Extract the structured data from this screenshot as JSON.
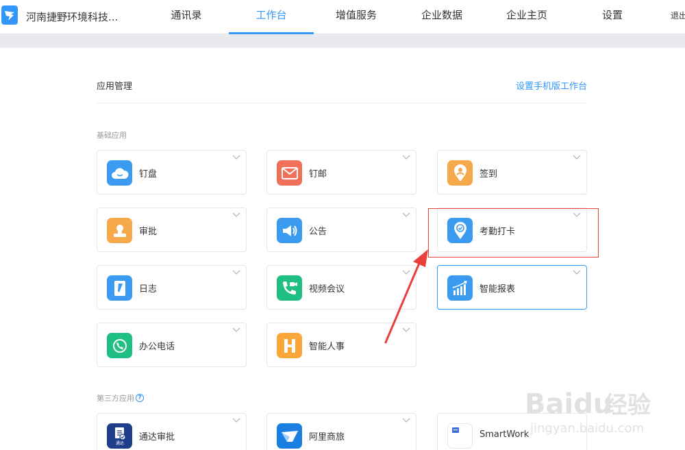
{
  "header": {
    "company": "河南捷野环境科技...",
    "tabs": [
      {
        "label": "通讯录"
      },
      {
        "label": "工作台"
      },
      {
        "label": "增值服务"
      },
      {
        "label": "企业数据"
      },
      {
        "label": "企业主页"
      },
      {
        "label": "设置"
      }
    ],
    "active_tab": "工作台",
    "logout": "退出"
  },
  "main": {
    "title": "应用管理",
    "mobile_link": "设置手机版工作台",
    "basic_label": "基础应用",
    "basic_apps": [
      {
        "name": "钉盘",
        "icon": "cloud-icon",
        "color": "#3a9bf0"
      },
      {
        "name": "钉邮",
        "icon": "mail-icon",
        "color": "#f0705a"
      },
      {
        "name": "签到",
        "icon": "location-pin-icon",
        "color": "#f5a94a"
      },
      {
        "name": "审批",
        "icon": "stamp-icon",
        "color": "#f5a94a"
      },
      {
        "name": "公告",
        "icon": "megaphone-icon",
        "color": "#3a9bf0"
      },
      {
        "name": "考勤打卡",
        "icon": "check-pin-icon",
        "color": "#3a9bf0"
      },
      {
        "name": "日志",
        "icon": "notebook-icon",
        "color": "#3a9bf0"
      },
      {
        "name": "视频会议",
        "icon": "video-phone-icon",
        "color": "#1fbf83"
      },
      {
        "name": "智能报表",
        "icon": "chart-icon",
        "color": "#3a9bf0"
      },
      {
        "name": "办公电话",
        "icon": "phone-circle-icon",
        "color": "#1fbf83"
      },
      {
        "name": "智能人事",
        "icon": "h-letter-icon",
        "color": "#fba63a"
      }
    ],
    "third_label": "第三方应用",
    "third_apps": [
      {
        "name": "通达审批",
        "icon": "document-check-icon",
        "icon_text": "通达",
        "color": "#1f3e8a"
      },
      {
        "name": "阿里商旅",
        "icon": "plane-wing-icon",
        "color": "#1a7fe0"
      },
      {
        "name": "SmartWork",
        "icon": "smartwork-icon",
        "color": "#ffffff"
      }
    ]
  },
  "watermark": {
    "brand": "Baidu",
    "suffix": "经验",
    "url": "jingyan.baidu.com"
  }
}
